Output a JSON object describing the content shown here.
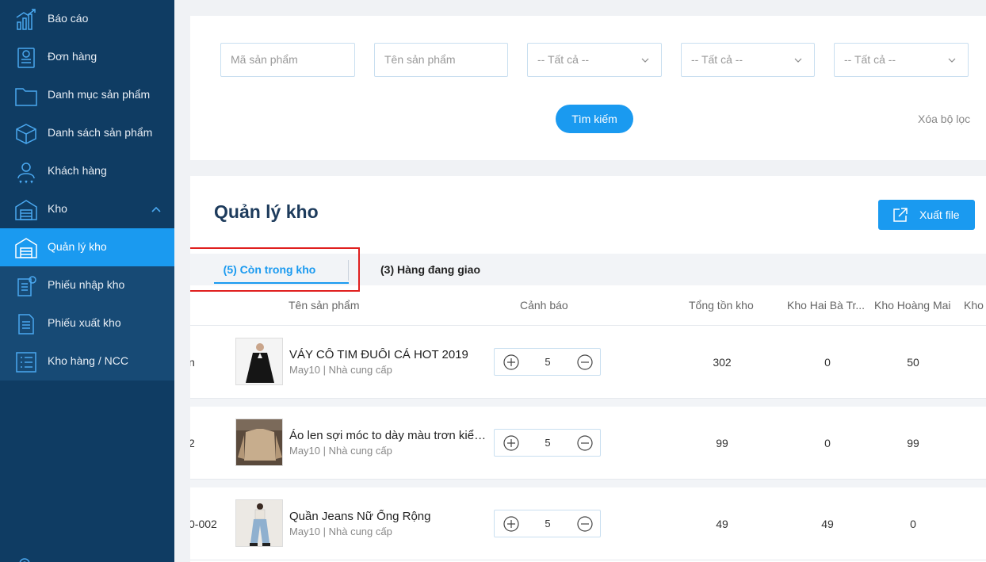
{
  "sidebar": {
    "items": [
      {
        "label": "Báo cáo",
        "icon": "chart-icon"
      },
      {
        "label": "Đơn hàng",
        "icon": "invoice-icon"
      },
      {
        "label": "Danh mục sản phẩm",
        "icon": "folder-icon"
      },
      {
        "label": "Danh sách sản phẩm",
        "icon": "box-icon"
      },
      {
        "label": "Khách hàng",
        "icon": "customer-icon"
      },
      {
        "label": "Kho",
        "icon": "warehouse-icon"
      }
    ],
    "sub_items": [
      {
        "label": "Quản lý kho",
        "icon": "warehouse-icon",
        "active": true
      },
      {
        "label": "Phiếu nhập kho",
        "icon": "import-slip-icon"
      },
      {
        "label": "Phiếu xuất kho",
        "icon": "export-slip-icon"
      },
      {
        "label": "Kho hàng / NCC",
        "icon": "list-icon"
      }
    ]
  },
  "filters": {
    "product_code_placeholder": "Mã sản phẩm",
    "product_name_placeholder": "Tên sản phẩm",
    "select_1": "-- Tất cả --",
    "select_2": "-- Tất cả --",
    "select_3": "-- Tất cả --",
    "search_label": "Tìm kiếm",
    "clear_label": "Xóa bộ lọc"
  },
  "main": {
    "title": "Quản lý kho",
    "export_label": "Xuất file",
    "tabs": [
      {
        "label": "(5) Còn trong kho",
        "active": true
      },
      {
        "label": "(3) Hàng đang giao",
        "active": false
      }
    ],
    "columns": [
      "Tên sản phẩm",
      "Cảnh báo",
      "Tổng tồn kho",
      "Kho Hai Bà Tr...",
      "Kho Hoàng Mai",
      "Kho"
    ],
    "rows": [
      {
        "code": "n",
        "name": "VÁY CÔ TIM ĐUÔI CÁ HOT 2019",
        "meta": "May10 | Nhà cung cấp",
        "warning": "5",
        "total": "302",
        "kho_hbt": "0",
        "kho_hm": "50"
      },
      {
        "code": "2",
        "name": "Áo len sợi móc to dày màu trơn kiểu...",
        "meta": "May10 | Nhà cung cấp",
        "warning": "5",
        "total": "99",
        "kho_hbt": "0",
        "kho_hm": "99"
      },
      {
        "code": "0-002",
        "name": "Quần Jeans Nữ Ống Rộng",
        "meta": "May10 | Nhà cung cấp",
        "warning": "5",
        "total": "49",
        "kho_hbt": "49",
        "kho_hm": "0"
      }
    ]
  },
  "colors": {
    "sidebar": "#0f3c63",
    "accent": "#1a9af0",
    "highlight": "#e0201f"
  }
}
